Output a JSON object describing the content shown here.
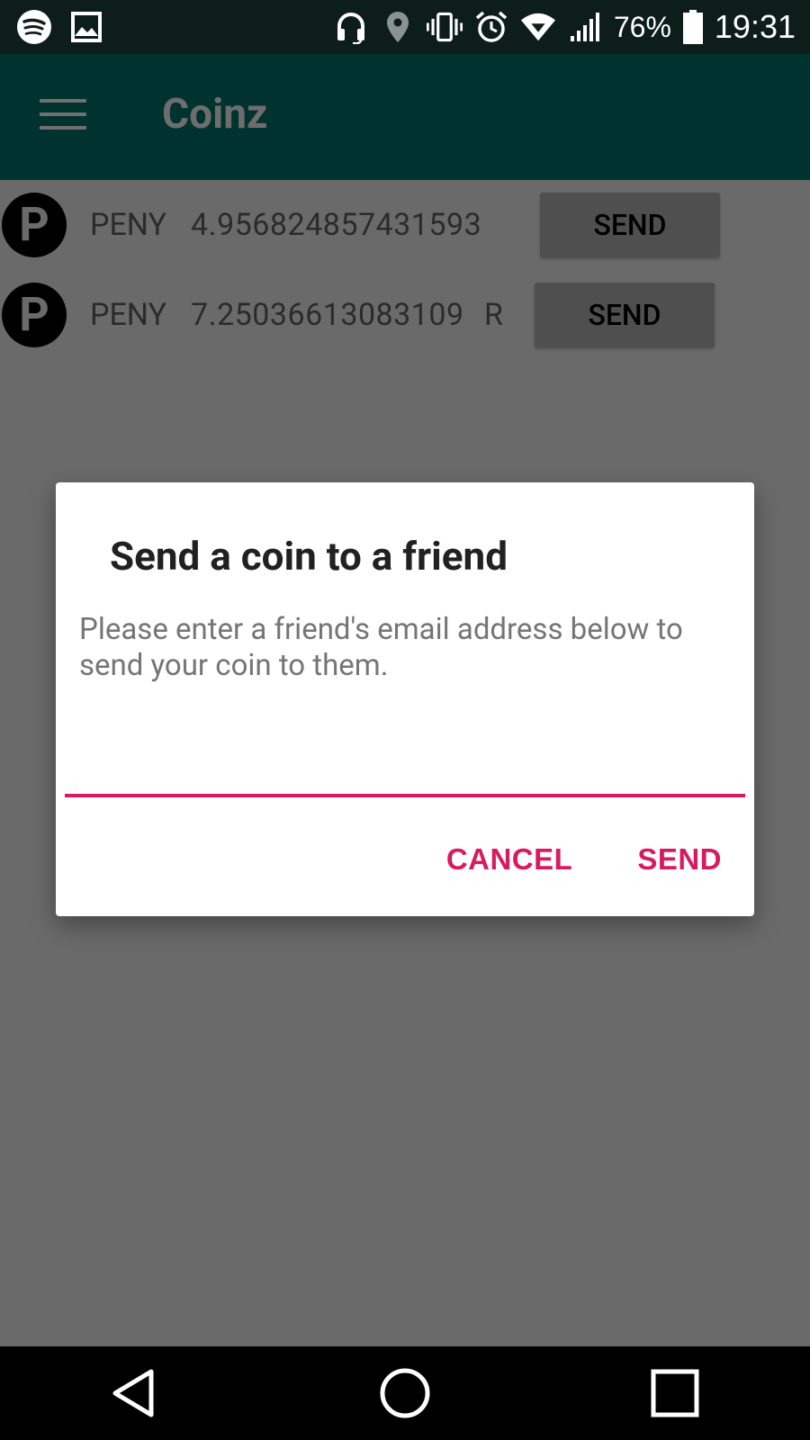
{
  "status_bar": {
    "battery": "76%",
    "time": "19:31"
  },
  "app_bar": {
    "title": "Coinz"
  },
  "coins": [
    {
      "icon_letter": "P",
      "currency": "PENY",
      "value": "4.956824857431593",
      "flag": "",
      "send_label": "SEND"
    },
    {
      "icon_letter": "P",
      "currency": "PENY",
      "value": "7.25036613083109",
      "flag": "R",
      "send_label": "SEND"
    }
  ],
  "dialog": {
    "title": "Send a coin to a friend",
    "message": "Please enter a friend's email address below to send your coin to them.",
    "input_value": "",
    "cancel_label": "CANCEL",
    "send_label": "SEND"
  },
  "colors": {
    "accent": "#d81b60",
    "app_bar": "#00332f",
    "scrim": "#6a6a6a"
  }
}
